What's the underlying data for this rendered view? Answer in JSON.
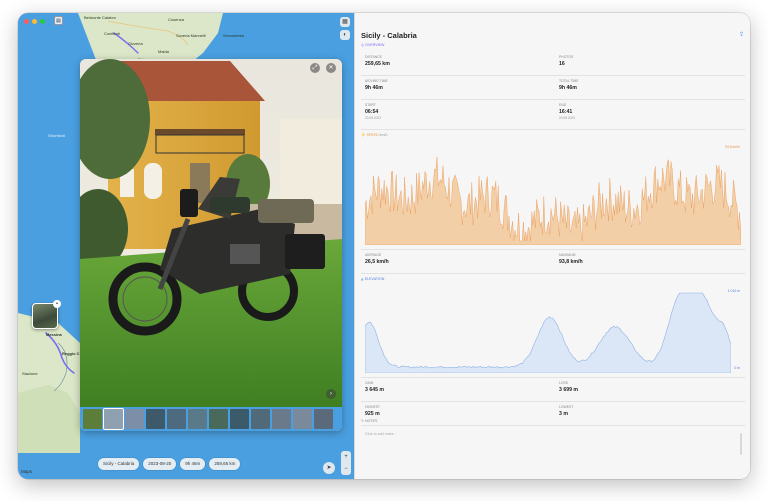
{
  "map": {
    "labels": [
      "Belmonte Calabro",
      "Cosenza",
      "Soveria Mannelli",
      "Serrastretta",
      "Conflenti",
      "Gizzeria",
      "Maida",
      "Bivio",
      "Stromboli",
      "Messina",
      "Reggio C",
      "Stazione"
    ],
    "logo": "Maps",
    "chips": [
      "Sicily - Calabria",
      "2023-08-20",
      "9h 46m",
      "259,65 km"
    ]
  },
  "panel": {
    "title": "Sicily - Calabria",
    "overview_label": "OVERVIEW",
    "stats": [
      {
        "label": "DISTANCE",
        "value": "259,65 km",
        "sub": ""
      },
      {
        "label": "PHOTOS",
        "value": "16",
        "sub": ""
      },
      {
        "label": "MOVING TIME",
        "value": "9h 46m",
        "sub": ""
      },
      {
        "label": "TOTAL TIME",
        "value": "9h 46m",
        "sub": ""
      },
      {
        "label": "START",
        "value": "06:54",
        "sub": "20.08.2023"
      },
      {
        "label": "END",
        "value": "16:41",
        "sub": "20.08.2023"
      }
    ],
    "speed_label": "SPEED",
    "speed_unit": "km/h",
    "speed_scale": "93.8 km/h",
    "speed_stats": [
      {
        "label": "AVERAGE",
        "value": "26,5 km/h"
      },
      {
        "label": "MAXIMUM",
        "value": "93,8 km/h"
      }
    ],
    "elevation_label": "ELEVATION",
    "elevation_max": "1 010 m",
    "elevation_min": "0 m",
    "elevation_stats": [
      {
        "label": "GAIN",
        "value": "3 645 m"
      },
      {
        "label": "LOSS",
        "value": "3 699 m"
      },
      {
        "label": "HIGHEST",
        "value": "925 m"
      },
      {
        "label": "LOWEST",
        "value": "3 m"
      }
    ],
    "notes_label": "NOTES",
    "notes_placeholder": "Click to add notes..."
  },
  "colors": {
    "accent": "#7a6cf0",
    "speed": "#e8944a",
    "elevation": "#8fb2e6",
    "water": "#4a9fe0",
    "land": "#dbe7c8"
  }
}
